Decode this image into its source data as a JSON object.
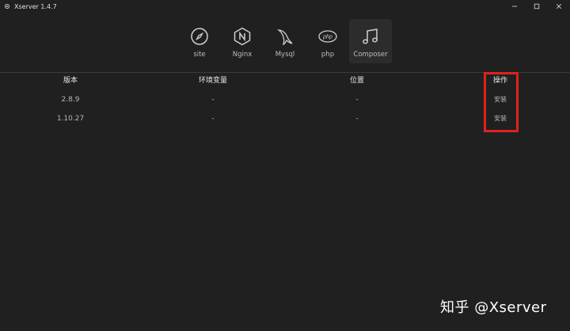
{
  "window": {
    "title": "Xserver 1.4.7"
  },
  "toolbar": {
    "items": [
      {
        "label": "site",
        "icon": "compass-icon"
      },
      {
        "label": "Nginx",
        "icon": "nginx-icon"
      },
      {
        "label": "Mysql",
        "icon": "mysql-dolphin-icon"
      },
      {
        "label": "php",
        "icon": "php-icon"
      },
      {
        "label": "Composer",
        "icon": "music-note-icon",
        "active": true
      }
    ]
  },
  "table": {
    "headers": [
      "版本",
      "环境变量",
      "位置",
      "操作"
    ],
    "rows": [
      {
        "version": "2.8.9",
        "env": "-",
        "location": "-",
        "action": "安装"
      },
      {
        "version": "1.10.27",
        "env": "-",
        "location": "-",
        "action": "安装"
      }
    ]
  },
  "watermark": "知乎 @Xserver",
  "colors": {
    "background": "#202020",
    "install": "#3fbf4b",
    "highlight": "#e02020"
  }
}
